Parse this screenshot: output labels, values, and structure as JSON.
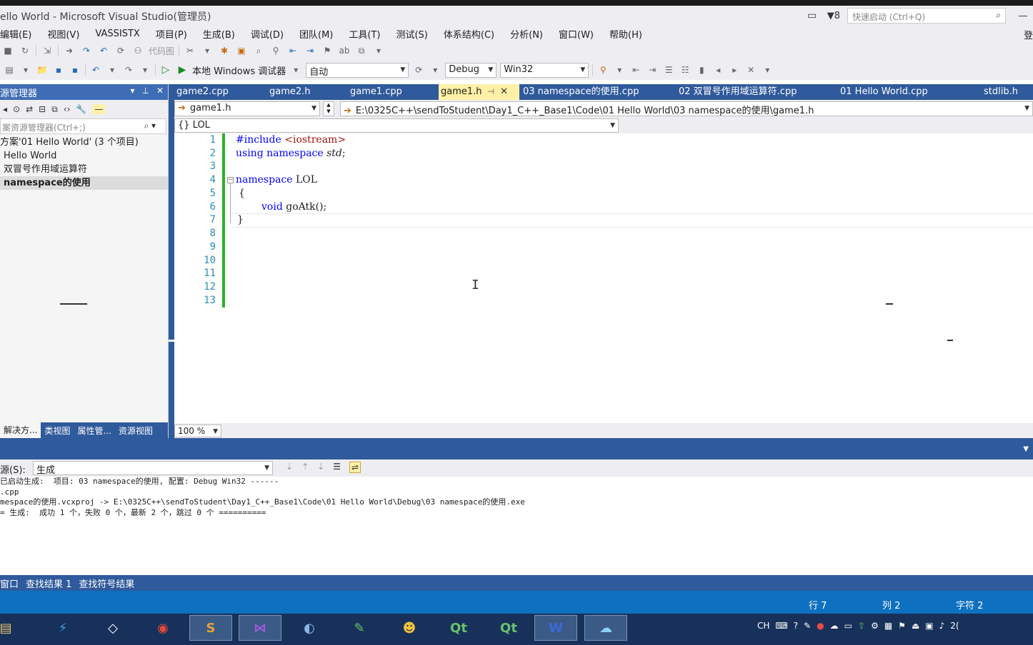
{
  "window": {
    "title": "ello World - Microsoft Visual Studio(管理员)",
    "filter_count": "8",
    "quick_launch_placeholder": "快速启动 (Ctrl+Q)",
    "login": "登"
  },
  "menu": [
    "编辑(E)",
    "视图(V)",
    "VASSISTX",
    "项目(P)",
    "生成(B)",
    "调试(D)",
    "团队(M)",
    "工具(T)",
    "测试(S)",
    "体系结构(C)",
    "分析(N)",
    "窗口(W)",
    "帮助(H)"
  ],
  "toolbar1": {
    "code_map_label": "代码图"
  },
  "toolbar2": {
    "run_label": "本地 Windows 调试器",
    "auto_label": "自动",
    "config": "Debug",
    "platform": "Win32"
  },
  "solution_explorer": {
    "title": "源管理器",
    "search_placeholder": "案资源管理器(Ctrl+;)",
    "items": [
      "方案'01 Hello World' (3 个项目)",
      "Hello World",
      "双冒号作用域运算符",
      "namespace的使用"
    ],
    "tabs": [
      "解决方...",
      "类视图",
      "属性管...",
      "资源视图"
    ]
  },
  "doc_tabs": [
    "game2.cpp",
    "game2.h",
    "game1.cpp",
    "game1.h",
    "03 namespace的使用.cpp",
    "02 双冒号作用域运算符.cpp",
    "01 Hello World.cpp",
    "stdlib.h"
  ],
  "nav": {
    "file": "game1.h",
    "path": "E:\\0325C++\\sendToStudent\\Day1_C++_Base1\\Code\\01 Hello World\\03 namespace的使用\\game1.h",
    "scope": "{} LOL"
  },
  "editor": {
    "line_numbers": [
      "1",
      "2",
      "3",
      "4",
      "5",
      "6",
      "7",
      "8",
      "9",
      "10",
      "11",
      "12",
      "13"
    ],
    "lines": {
      "l1_kw": "#include",
      "l1_inc": "<iostream>",
      "l2_kw1": "using",
      "l2_kw2": "namespace",
      "l2_std": "std",
      "l2_semi": ";",
      "l4_kw": "namespace",
      "l4_name": "LOL",
      "l5": "{",
      "l6_kw": "void",
      "l6_rest": "goAtk();",
      "l7": "}"
    },
    "zoom": "100 %"
  },
  "output": {
    "label": "源(S):",
    "source": "生成",
    "lines": [
      "已启动生成:  项目: 03 namespace的使用, 配置: Debug Win32 ------",
      ".cpp",
      "mespace的使用.vcxproj -> E:\\0325C++\\sendToStudent\\Day1_C++_Base1\\Code\\01 Hello World\\Debug\\03 namespace的使用.exe",
      "= 生成:  成功 1 个，失败 0 个，最新 2 个，跳过 0 个 =========="
    ]
  },
  "bottom_tabs": [
    "窗口",
    "查找结果 1",
    "查找符号结果"
  ],
  "status": {
    "line": "行 7",
    "col": "列 2",
    "char": "字符 2"
  },
  "taskbar": {
    "tray_lang": "CH",
    "time_fragment": "2("
  }
}
